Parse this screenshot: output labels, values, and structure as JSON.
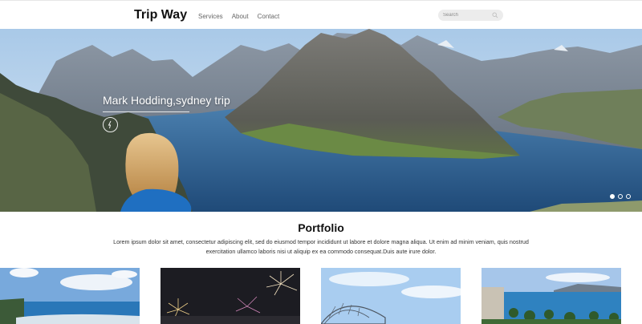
{
  "header": {
    "brand": "Trip Way",
    "nav": [
      "Services",
      "About",
      "Contact"
    ],
    "search_placeholder": "Search"
  },
  "hero": {
    "caption": "Mark Hodding,sydney trip",
    "slides": 3,
    "active_slide": 1
  },
  "portfolio": {
    "title": "Portfolio",
    "description": "Lorem ipsum dolor sit amet, consectetur adipiscing elit, sed do eiusmod tempor incididunt ut labore et dolore magna aliqua. Ut enim ad minim veniam, quis nostrud exercitation ullamco laboris nisi ut aliquip ex ea commodo consequat.Duis aute irure dolor.",
    "thumbnails": [
      "beach-coast",
      "fireworks-night",
      "sky-dome",
      "tropical-resort"
    ]
  },
  "icons": {
    "search": "search-icon",
    "play": "play-icon"
  },
  "colors": {
    "sea": "#2f5f8e",
    "sky": "#b9d4ec",
    "search_bg": "#ececec"
  }
}
